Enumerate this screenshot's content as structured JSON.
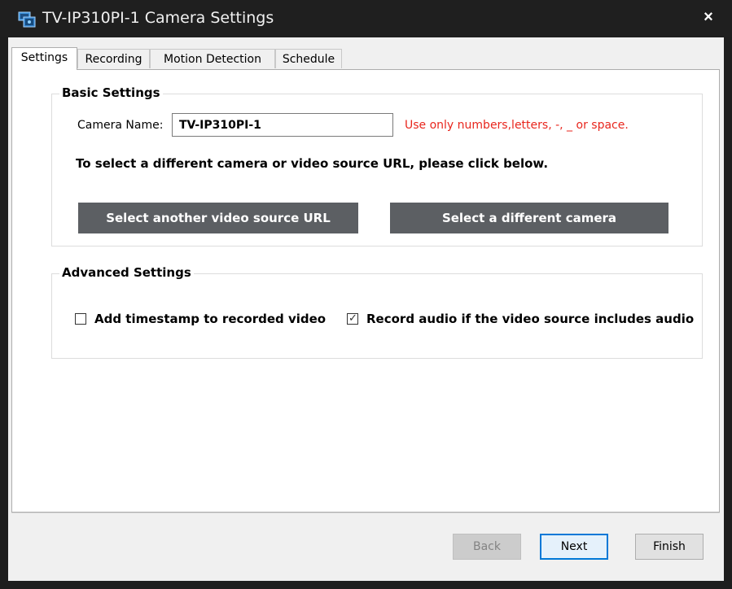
{
  "window": {
    "title": "TV-IP310PI-1 Camera Settings",
    "close_glyph": "×"
  },
  "tabs": [
    {
      "label": "Settings",
      "active": true
    },
    {
      "label": "Recording",
      "active": false
    },
    {
      "label": "Motion Detection",
      "active": false
    },
    {
      "label": "Schedule",
      "active": false
    }
  ],
  "basic": {
    "title": "Basic Settings",
    "camera_name_label": "Camera Name:",
    "camera_name_value": "TV-IP310PI-1",
    "hint": "Use only numbers,letters, -, _ or space.",
    "instruction": "To select a different camera or video source URL, please click below.",
    "btn_video_url": "Select another video source URL",
    "btn_different_camera": "Select a different camera"
  },
  "advanced": {
    "title": "Advanced Settings",
    "timestamp_label": "Add timestamp to recorded video",
    "timestamp_checked": false,
    "audio_label": "Record audio if the video source includes audio",
    "audio_checked": true
  },
  "footer": {
    "back": "Back",
    "next": "Next",
    "finish": "Finish"
  },
  "colors": {
    "hint_red": "#e8261d",
    "dark_button": "#5c5f63",
    "titlebar": "#1f1f1f",
    "focus_blue": "#0078d7"
  },
  "icons": {
    "app": "camera-app-icon",
    "close": "close-icon",
    "check": "checkmark-icon"
  }
}
